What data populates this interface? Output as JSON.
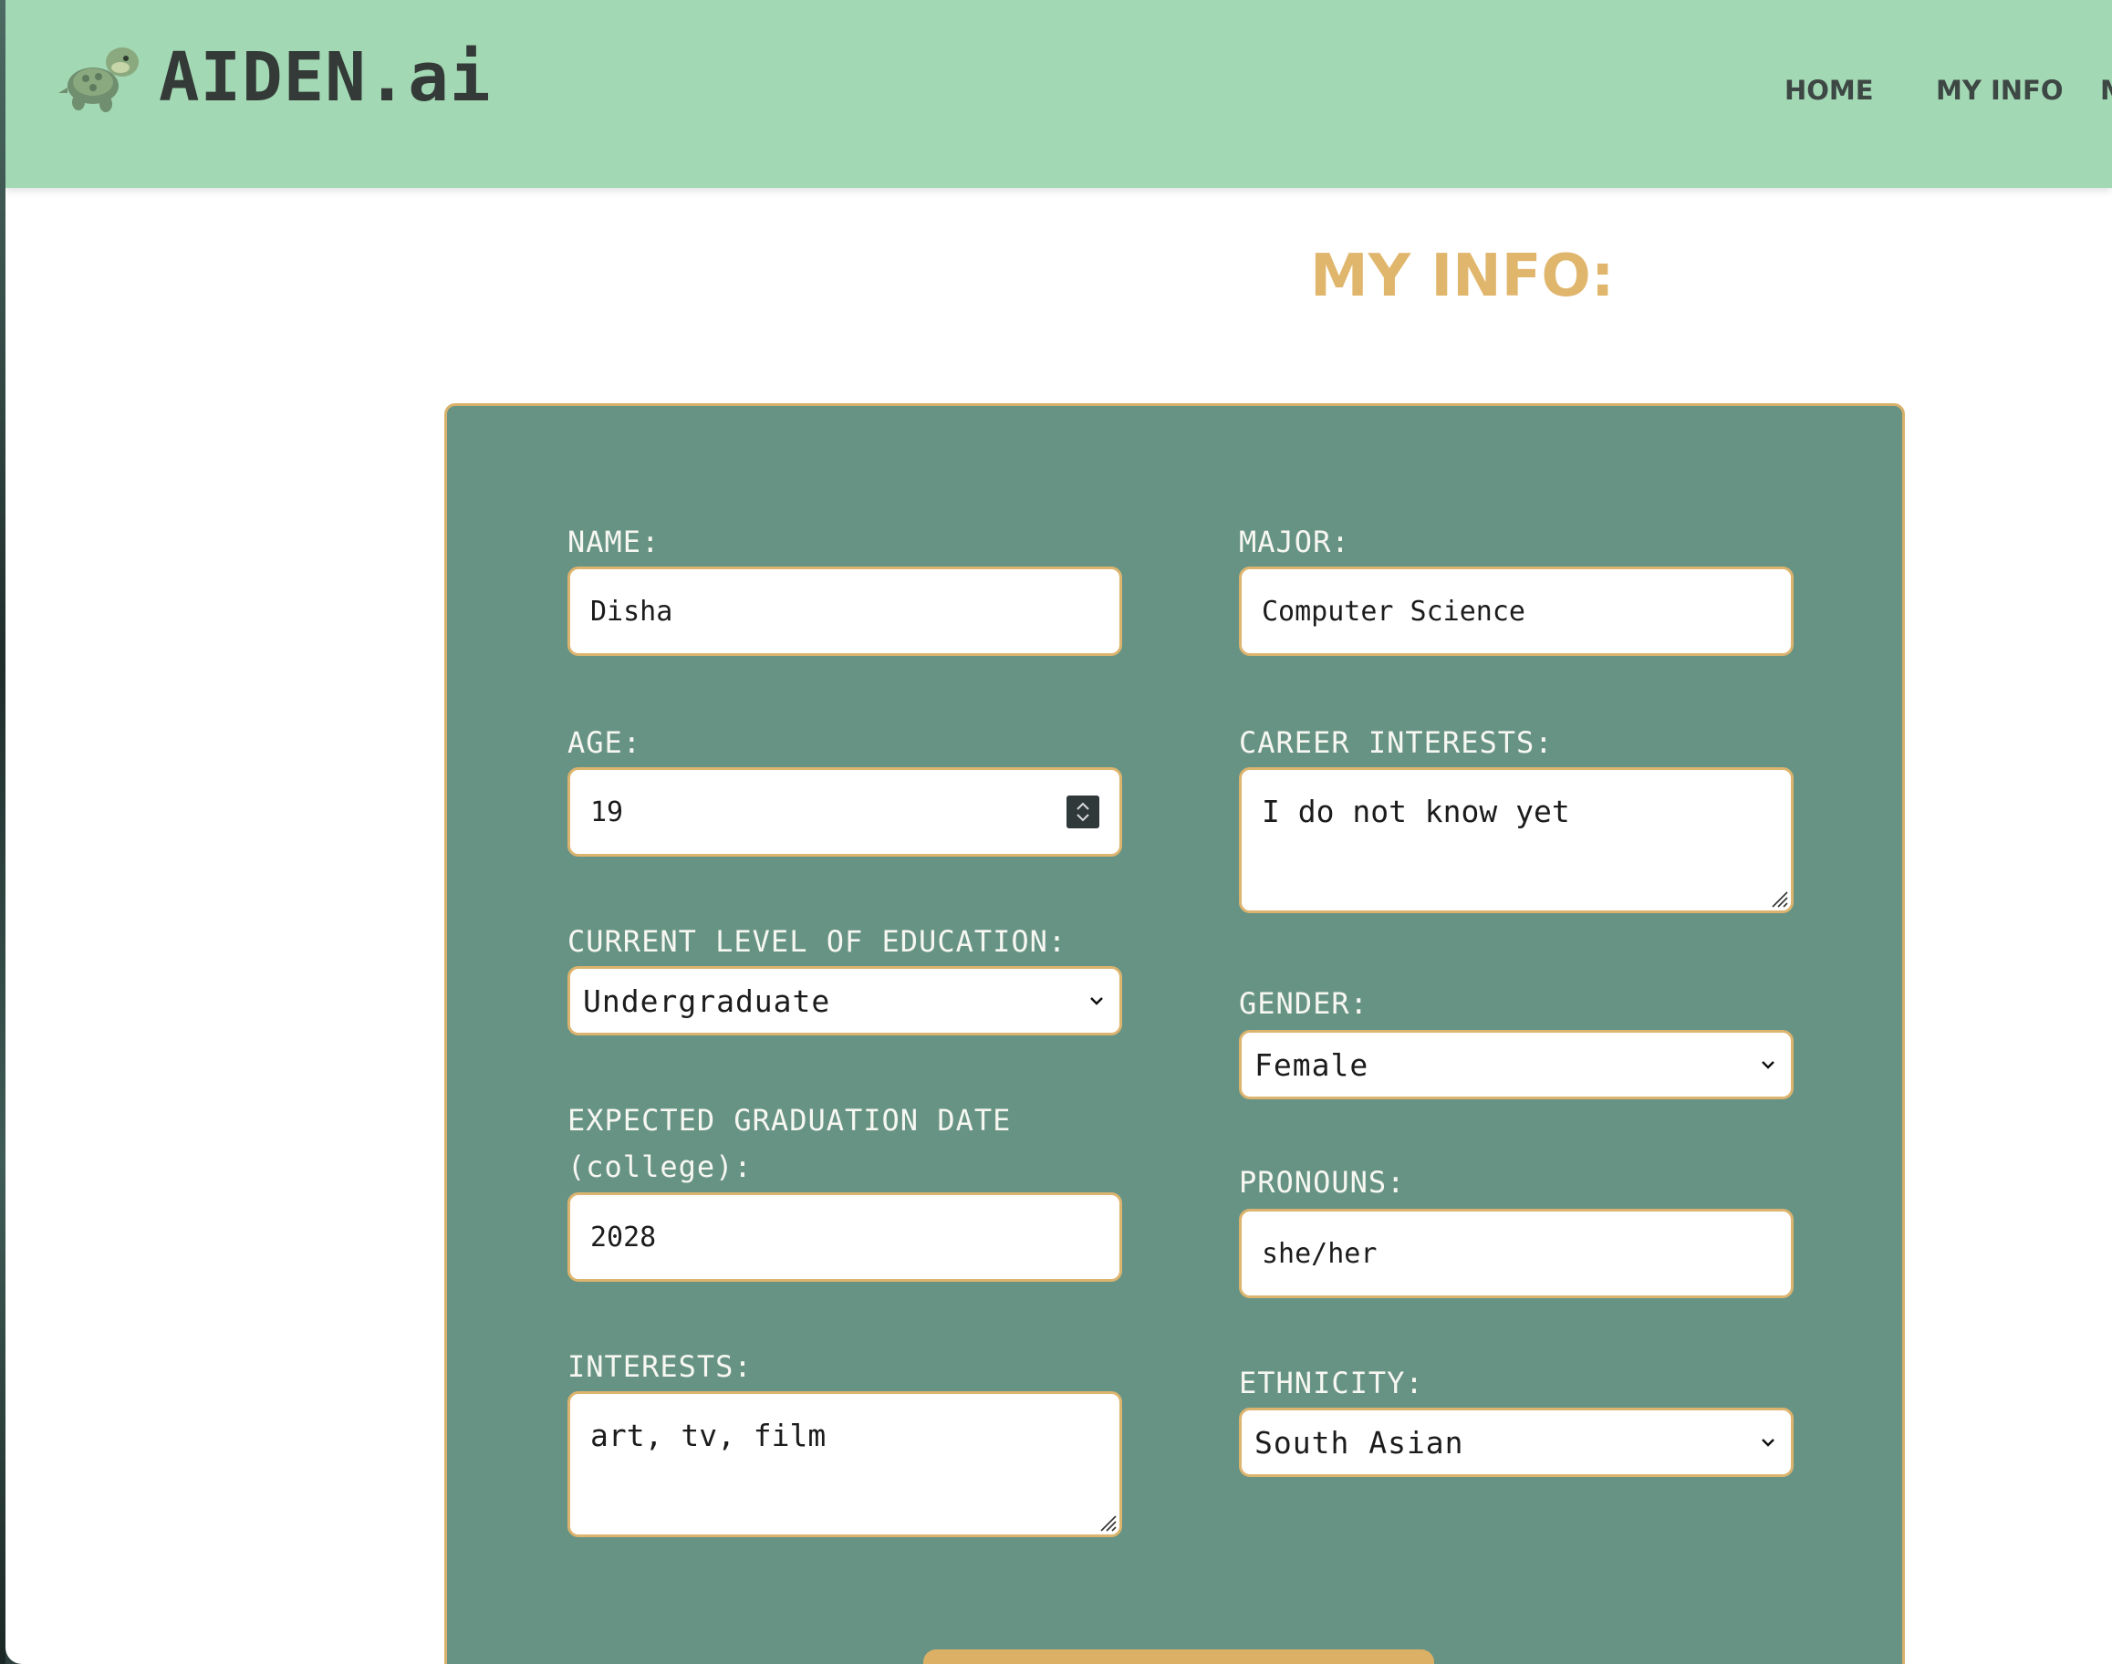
{
  "header": {
    "brand": "AIDEN.ai",
    "logo_icon": "turtle-icon",
    "nav": [
      {
        "label": "HOME"
      },
      {
        "label": "MY INFO"
      },
      {
        "label": "M"
      }
    ]
  },
  "page_title": "MY INFO:",
  "form": {
    "name": {
      "label": "NAME:",
      "value": "Disha"
    },
    "major": {
      "label": "MAJOR:",
      "value": "Computer Science"
    },
    "age": {
      "label": "AGE:",
      "value": "19"
    },
    "career_interests": {
      "label": "CAREER INTERESTS:",
      "value": "I do not know yet"
    },
    "education": {
      "label": "CURRENT LEVEL OF EDUCATION:",
      "value": "Undergraduate"
    },
    "gender": {
      "label": "GENDER:",
      "value": "Female"
    },
    "graduation": {
      "label_line1": "EXPECTED GRADUATION DATE",
      "label_line2": "(college):",
      "value": "2028"
    },
    "pronouns": {
      "label": "PRONOUNS:",
      "value": "she/her"
    },
    "interests": {
      "label": "INTERESTS:",
      "value": "art, tv, film"
    },
    "ethnicity": {
      "label": "ETHNICITY:",
      "value": "South Asian"
    }
  },
  "colors": {
    "header_bg": "#a3d8b4",
    "title": "#e0b66d",
    "card_bg": "#679385",
    "accent_border": "#ddb46e",
    "submit": "#dcb065"
  }
}
